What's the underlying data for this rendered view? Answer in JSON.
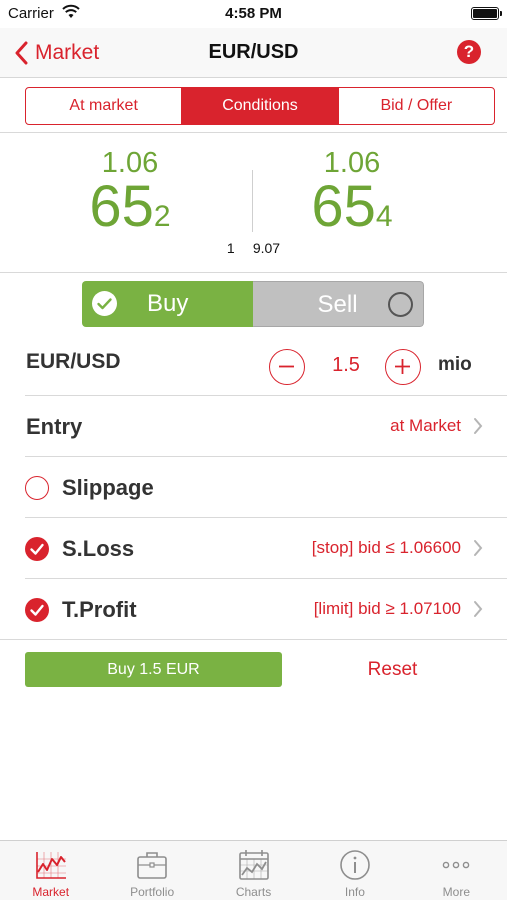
{
  "status_bar": {
    "carrier": "Carrier",
    "time": "4:58 PM"
  },
  "nav": {
    "back_label": "Market",
    "title": "EUR/USD",
    "help_label": "?"
  },
  "segments": [
    {
      "label": "At market",
      "active": false
    },
    {
      "label": "Conditions",
      "active": true
    },
    {
      "label": "Bid / Offer",
      "active": false
    }
  ],
  "quote": {
    "bid": {
      "prefix": "1.06",
      "big": "65",
      "pip": "2"
    },
    "ask": {
      "prefix": "1.06",
      "big": "65",
      "pip": "4"
    },
    "spread": {
      "left": "1",
      "right": "9.07"
    }
  },
  "side_toggle": {
    "buy_label": "Buy",
    "sell_label": "Sell",
    "selected": "Buy"
  },
  "quantity": {
    "pair": "EUR/USD",
    "value": "1.5",
    "unit": "mio"
  },
  "entry": {
    "label": "Entry",
    "value": "at Market"
  },
  "slippage": {
    "label": "Slippage",
    "checked": false
  },
  "stop_loss": {
    "label": "S.Loss",
    "value": "[stop] bid ≤ 1.06600",
    "checked": true
  },
  "take_profit": {
    "label": "T.Profit",
    "value": "[limit] bid ≥ 1.07100",
    "checked": true
  },
  "actions": {
    "buy_label": "Buy 1.5 EUR",
    "reset_label": "Reset"
  },
  "tabs": [
    {
      "label": "Market",
      "icon": "market-chart-icon",
      "active": true
    },
    {
      "label": "Portfolio",
      "icon": "briefcase-icon",
      "active": false
    },
    {
      "label": "Charts",
      "icon": "calendar-chart-icon",
      "active": false
    },
    {
      "label": "Info",
      "icon": "info-icon",
      "active": false
    },
    {
      "label": "More",
      "icon": "more-dots-icon",
      "active": false
    }
  ],
  "colors": {
    "accent": "#d9232d",
    "price_green": "#6ea536",
    "buy_green": "#7ab243",
    "sell_gray": "#c0c0c0"
  }
}
